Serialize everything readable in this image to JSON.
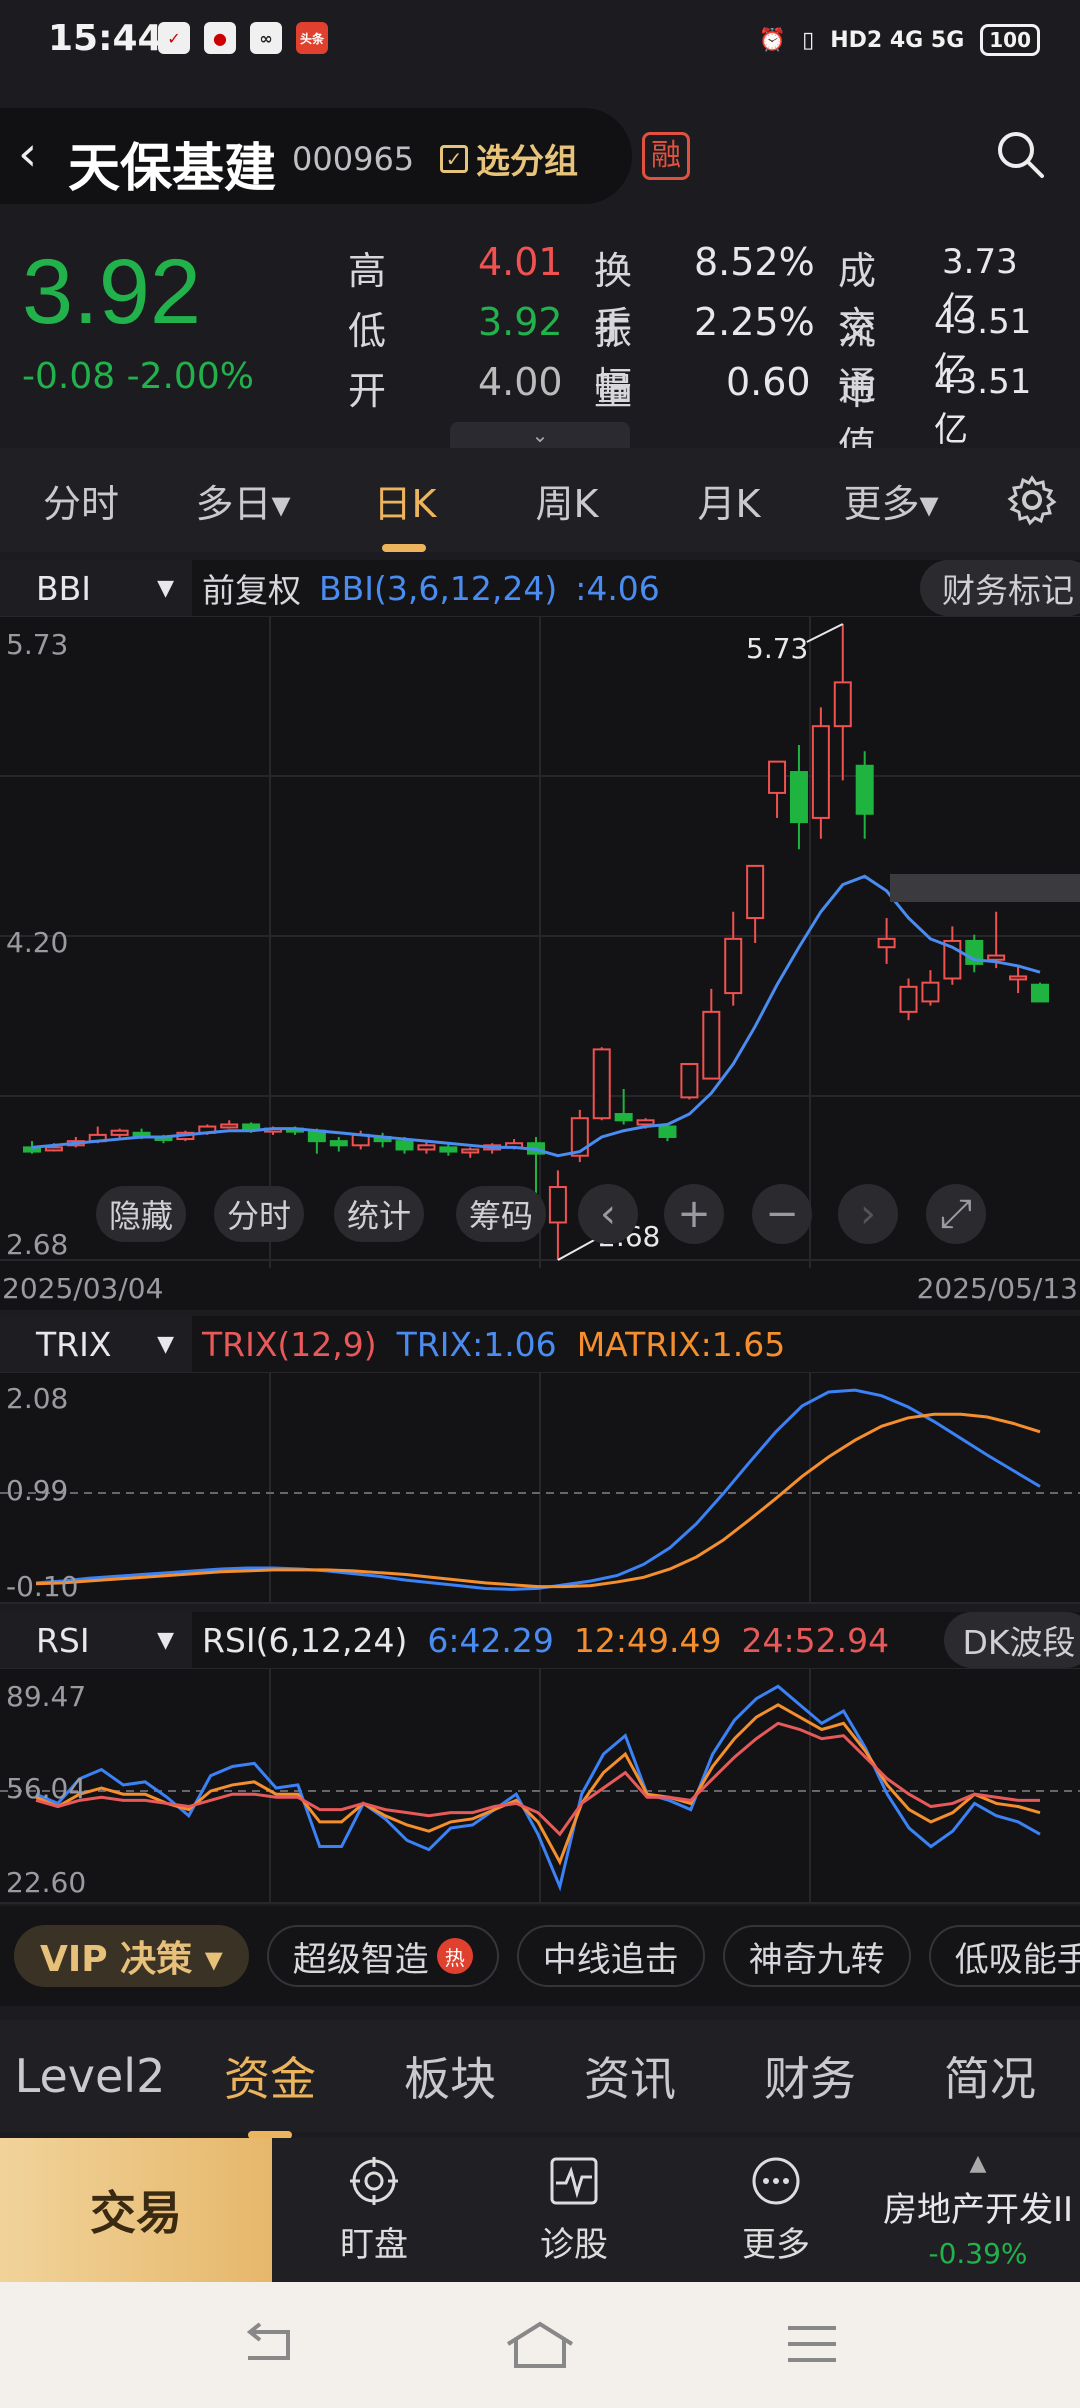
{
  "status": {
    "time": "15:44",
    "signal": "HD2 4G 5G",
    "battery": "100"
  },
  "header": {
    "name": "天保基建",
    "code": "000965",
    "group_label": "选分组",
    "badge": "融"
  },
  "quote": {
    "price": "3.92",
    "change": "-0.08 -2.00%",
    "rows": [
      {
        "l1": "高",
        "v1": "4.01",
        "c1": "red",
        "l2": "换手",
        "v2": "8.52%",
        "l3": "成交",
        "v3": "3.73亿"
      },
      {
        "l1": "低",
        "v1": "3.92",
        "c1": "green",
        "l2": "振幅",
        "v2": "2.25%",
        "l3": "流通",
        "v3": "43.51亿"
      },
      {
        "l1": "开",
        "v1": "4.00",
        "c1": "gray",
        "l2": "量比",
        "v2": "0.60",
        "l3": "市值",
        "v3": "43.51亿"
      }
    ]
  },
  "tabs": [
    {
      "label": "分时"
    },
    {
      "label": "多日▾"
    },
    {
      "label": "日K"
    },
    {
      "label": "周K"
    },
    {
      "label": "月K"
    },
    {
      "label": "更多▾"
    }
  ],
  "main_indicator": {
    "select": "BBI",
    "adjust": "前复权",
    "params": "BBI(3,6,12,24)",
    "value": ":4.06",
    "finance_btn": "财务标记"
  },
  "main_axis": {
    "high": "5.73",
    "mid": "4.20",
    "low": "2.68",
    "max_label": "5.73",
    "min_label": "2.68",
    "date_start": "2025/03/04",
    "date_end": "2025/05/13"
  },
  "overlay_buttons": {
    "hide": "隐藏",
    "intraday": "分时",
    "stats": "统计",
    "chips": "筹码"
  },
  "trix": {
    "select": "TRIX",
    "params": "TRIX(12,9)",
    "trix": "TRIX:1.06",
    "matrix": "MATRIX:1.65",
    "y_top": "2.08",
    "y_mid": "0.99",
    "y_low": "-0.10"
  },
  "rsi": {
    "select": "RSI",
    "params": "RSI(6,12,24)",
    "r6": "6:42.29",
    "r12": "12:49.49",
    "r24": "24:52.94",
    "btn": "DK波段",
    "y_top": "89.47",
    "y_mid": "56.04",
    "y_low": "22.60"
  },
  "strategies": {
    "vip": "VIP 决策 ▾",
    "chips": [
      "超级智造",
      "中线追击",
      "神奇九转",
      "低吸能手"
    ],
    "hot": "热"
  },
  "bottom_tabs": [
    {
      "label": "Level2"
    },
    {
      "label": "资金"
    },
    {
      "label": "板块"
    },
    {
      "label": "资讯"
    },
    {
      "label": "财务"
    },
    {
      "label": "简况"
    }
  ],
  "actions": {
    "trade": "交易",
    "watch": "盯盘",
    "diagnose": "诊股",
    "more": "更多",
    "sector_name": "房地产开发II",
    "sector_change": "-0.39%"
  },
  "chart_data": [
    {
      "type": "candlestick",
      "title": "",
      "ylim": [
        2.68,
        5.73
      ],
      "x_start": "2025/03/04",
      "x_end": "2025/05/13",
      "candles": [
        [
          3.22,
          3.25,
          3.2,
          3.19
        ],
        [
          3.22,
          3.24,
          3.22,
          3.2
        ],
        [
          3.23,
          3.27,
          3.25,
          3.22
        ],
        [
          3.25,
          3.32,
          3.28,
          3.24
        ],
        [
          3.28,
          3.31,
          3.3,
          3.26
        ],
        [
          3.29,
          3.31,
          3.28,
          3.26
        ],
        [
          3.27,
          3.28,
          3.26,
          3.24
        ],
        [
          3.26,
          3.3,
          3.29,
          3.25
        ],
        [
          3.29,
          3.33,
          3.32,
          3.28
        ],
        [
          3.32,
          3.35,
          3.33,
          3.31
        ],
        [
          3.33,
          3.34,
          3.31,
          3.29
        ],
        [
          3.3,
          3.32,
          3.31,
          3.28
        ],
        [
          3.31,
          3.32,
          3.3,
          3.28
        ],
        [
          3.3,
          3.31,
          3.25,
          3.19
        ],
        [
          3.25,
          3.27,
          3.23,
          3.2
        ],
        [
          3.23,
          3.3,
          3.28,
          3.21
        ],
        [
          3.27,
          3.29,
          3.25,
          3.22
        ],
        [
          3.25,
          3.27,
          3.21,
          3.19
        ],
        [
          3.21,
          3.25,
          3.23,
          3.19
        ],
        [
          3.22,
          3.24,
          3.2,
          3.18
        ],
        [
          3.2,
          3.22,
          3.21,
          3.17
        ],
        [
          3.21,
          3.24,
          3.23,
          3.19
        ],
        [
          3.22,
          3.26,
          3.24,
          3.21
        ],
        [
          3.24,
          3.27,
          3.19,
          2.95
        ],
        [
          2.86,
          3.11,
          3.03,
          2.68
        ],
        [
          3.18,
          3.4,
          3.36,
          3.15
        ],
        [
          3.36,
          3.7,
          3.69,
          3.35
        ],
        [
          3.38,
          3.5,
          3.35,
          3.33
        ],
        [
          3.33,
          3.36,
          3.35,
          3.31
        ],
        [
          3.32,
          3.33,
          3.27,
          3.25
        ],
        [
          3.46,
          3.59,
          3.62,
          3.45
        ],
        [
          3.55,
          3.98,
          3.87,
          3.55
        ],
        [
          3.96,
          4.35,
          4.22,
          3.9
        ],
        [
          4.32,
          4.57,
          4.57,
          4.2
        ],
        [
          4.92,
          5.02,
          5.07,
          4.8
        ],
        [
          5.02,
          5.15,
          4.78,
          4.65
        ],
        [
          4.8,
          5.33,
          5.24,
          4.7
        ],
        [
          5.24,
          5.73,
          5.45,
          4.98
        ],
        [
          5.05,
          5.12,
          4.82,
          4.7
        ],
        [
          4.18,
          4.32,
          4.22,
          4.1
        ],
        [
          3.87,
          4.03,
          3.99,
          3.83
        ],
        [
          3.92,
          4.07,
          4.01,
          3.9
        ],
        [
          4.03,
          4.28,
          4.21,
          4.0
        ],
        [
          4.21,
          4.24,
          4.1,
          4.06
        ],
        [
          4.12,
          4.35,
          4.14,
          4.08
        ],
        [
          4.04,
          4.09,
          4.04,
          3.96
        ],
        [
          4.0,
          4.01,
          3.92,
          3.92
        ]
      ],
      "bbi": [
        3.22,
        3.23,
        3.24,
        3.25,
        3.26,
        3.27,
        3.27,
        3.28,
        3.29,
        3.3,
        3.3,
        3.31,
        3.31,
        3.3,
        3.29,
        3.28,
        3.27,
        3.26,
        3.25,
        3.24,
        3.23,
        3.22,
        3.22,
        3.21,
        3.18,
        3.2,
        3.27,
        3.3,
        3.32,
        3.33,
        3.38,
        3.48,
        3.62,
        3.8,
        4.0,
        4.18,
        4.35,
        4.48,
        4.52,
        4.45,
        4.32,
        4.22,
        4.18,
        4.12,
        4.11,
        4.09,
        4.06
      ]
    },
    {
      "type": "line",
      "title": "TRIX(12,9)",
      "ylim": [
        -0.1,
        2.08
      ],
      "series": [
        {
          "name": "TRIX",
          "color": "#3b82f6",
          "values": [
            0.02,
            0.04,
            0.07,
            0.09,
            0.11,
            0.13,
            0.15,
            0.17,
            0.18,
            0.18,
            0.17,
            0.15,
            0.12,
            0.09,
            0.05,
            0.02,
            -0.01,
            -0.04,
            -0.05,
            -0.04,
            0.0,
            0.04,
            0.1,
            0.22,
            0.4,
            0.66,
            0.98,
            1.32,
            1.65,
            1.93,
            2.08,
            2.1,
            2.04,
            1.92,
            1.76,
            1.58,
            1.4,
            1.23,
            1.06
          ]
        },
        {
          "name": "MATRIX",
          "color": "#f58f2e",
          "values": [
            0.01,
            0.02,
            0.04,
            0.06,
            0.08,
            0.1,
            0.12,
            0.14,
            0.15,
            0.16,
            0.16,
            0.16,
            0.15,
            0.13,
            0.11,
            0.08,
            0.05,
            0.02,
            0.0,
            -0.02,
            -0.02,
            -0.01,
            0.03,
            0.08,
            0.17,
            0.3,
            0.48,
            0.7,
            0.93,
            1.17,
            1.38,
            1.56,
            1.71,
            1.8,
            1.84,
            1.84,
            1.81,
            1.74,
            1.65
          ]
        }
      ]
    },
    {
      "type": "line",
      "title": "RSI(6,12,24)",
      "ylim": [
        22.6,
        89.47
      ],
      "series": [
        {
          "name": "6",
          "color": "#3b82f6",
          "values": [
            55,
            52,
            60,
            63,
            58,
            59,
            54,
            48,
            61,
            64,
            65,
            57,
            58,
            38,
            38,
            52,
            47,
            40,
            37,
            44,
            45,
            50,
            55,
            42,
            25,
            55,
            68,
            74,
            55,
            53,
            50,
            68,
            79,
            86,
            90,
            84,
            78,
            82,
            70,
            55,
            44,
            38,
            43,
            52,
            48,
            46,
            42
          ]
        },
        {
          "name": "12",
          "color": "#f58f2e",
          "values": [
            54,
            51,
            55,
            57,
            55,
            55,
            52,
            50,
            56,
            58,
            59,
            55,
            55,
            46,
            46,
            52,
            48,
            45,
            43,
            46,
            47,
            50,
            53,
            46,
            33,
            52,
            62,
            68,
            55,
            54,
            52,
            64,
            73,
            80,
            84,
            80,
            76,
            78,
            69,
            58,
            50,
            46,
            49,
            55,
            52,
            51,
            49
          ]
        },
        {
          "name": "24",
          "color": "#e85a5a",
          "values": [
            53,
            51,
            53,
            54,
            53,
            53,
            52,
            51,
            53,
            55,
            55,
            54,
            54,
            50,
            50,
            52,
            50,
            49,
            48,
            49,
            49,
            51,
            52,
            49,
            42,
            52,
            57,
            62,
            54,
            54,
            53,
            60,
            67,
            73,
            78,
            76,
            73,
            74,
            67,
            60,
            55,
            51,
            52,
            55,
            54,
            53,
            53
          ]
        }
      ]
    }
  ]
}
